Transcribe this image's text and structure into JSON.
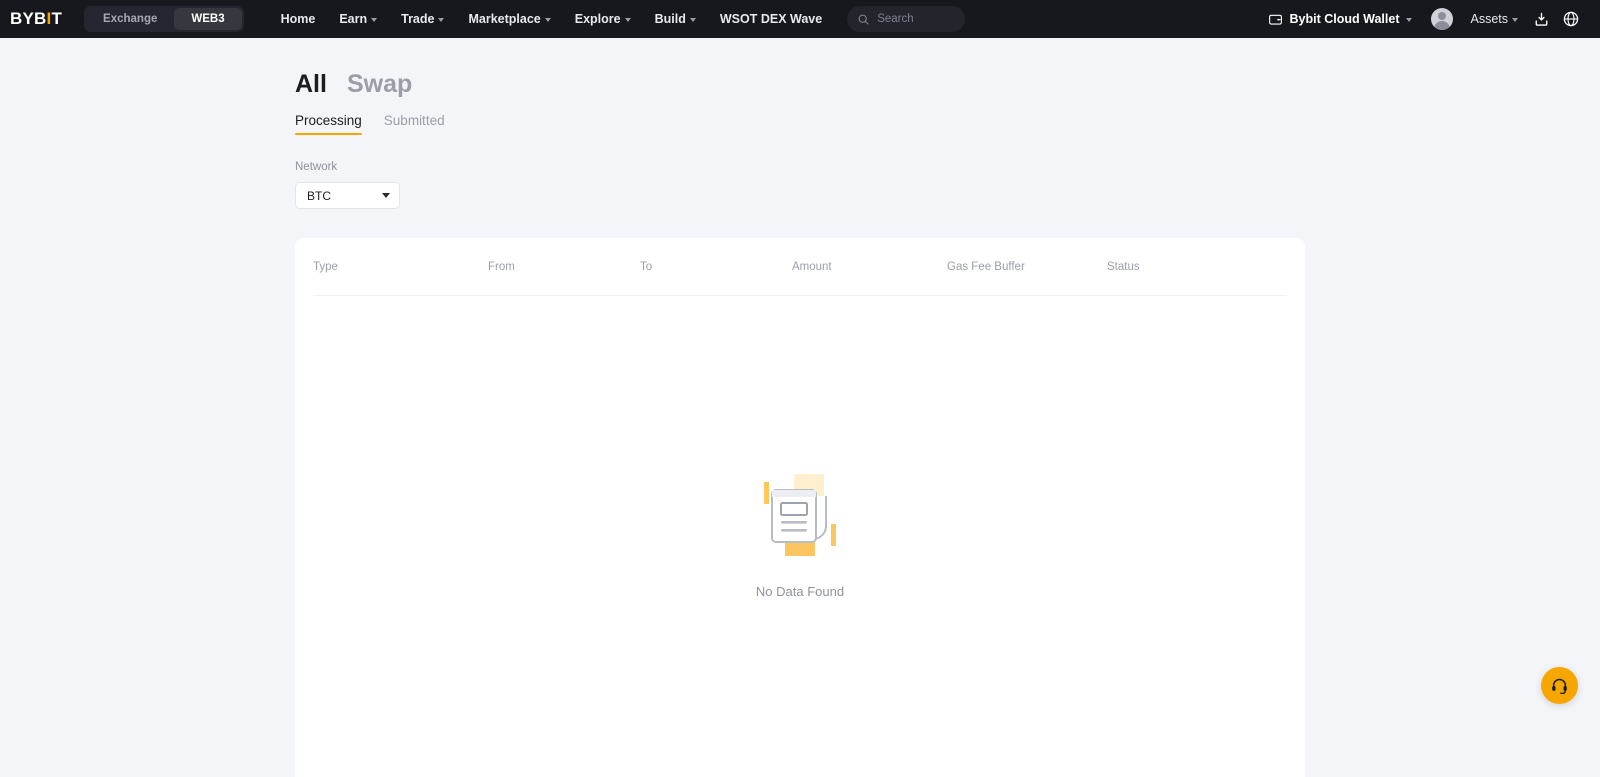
{
  "header": {
    "logo": {
      "prefix": "BYB",
      "accent": "I",
      "suffix": "T"
    },
    "segmented": [
      {
        "label": "Exchange",
        "active": false
      },
      {
        "label": "WEB3",
        "active": true
      }
    ],
    "nav": [
      {
        "label": "Home",
        "caret": false
      },
      {
        "label": "Earn",
        "caret": true
      },
      {
        "label": "Trade",
        "caret": true
      },
      {
        "label": "Marketplace",
        "caret": true
      },
      {
        "label": "Explore",
        "caret": true
      },
      {
        "label": "Build",
        "caret": true
      },
      {
        "label": "WSOT DEX Wave",
        "caret": false
      }
    ],
    "search": {
      "placeholder": "Search",
      "icon": "search-icon"
    },
    "wallet": {
      "label": "Bybit Cloud Wallet",
      "icon": "wallet-icon"
    },
    "assets": {
      "label": "Assets",
      "caret": true
    },
    "download_icon": "download-icon",
    "language_icon": "globe-icon"
  },
  "page": {
    "titles": [
      {
        "label": "All",
        "active": true
      },
      {
        "label": "Swap",
        "active": false
      }
    ],
    "subtabs": [
      {
        "label": "Processing",
        "active": true
      },
      {
        "label": "Submitted",
        "active": false
      }
    ],
    "network": {
      "label": "Network",
      "value": "BTC",
      "options": [
        "BTC"
      ]
    },
    "table": {
      "columns": [
        "Type",
        "From",
        "To",
        "Amount",
        "Gas Fee Buffer",
        "Status"
      ],
      "rows": []
    },
    "empty_state": {
      "text": "No Data Found",
      "illustration": "no-data-document-illustration"
    }
  },
  "support": {
    "icon": "headset-icon",
    "accent_color": "#f7a600"
  },
  "colors": {
    "brand": "#f7a600",
    "header_bg": "#17181e",
    "page_bg": "#f4f5f8",
    "card_bg": "#ffffff",
    "text_primary": "#1c1d22",
    "text_muted": "#9b9ea9"
  }
}
